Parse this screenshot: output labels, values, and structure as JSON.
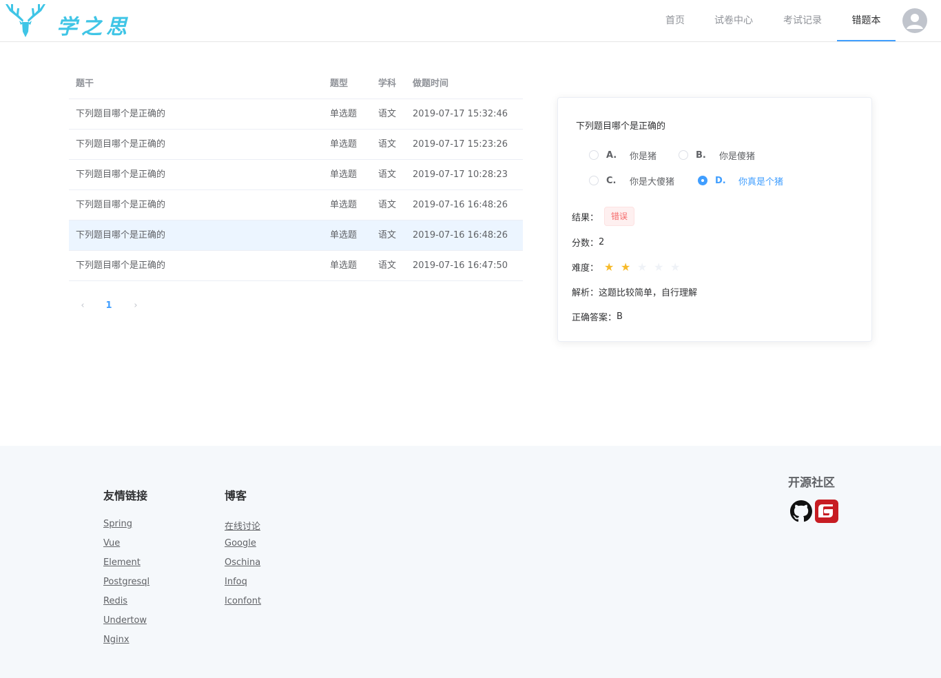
{
  "header": {
    "logo_text": "学之思",
    "nav": [
      {
        "label": "首页",
        "active": false
      },
      {
        "label": "试卷中心",
        "active": false
      },
      {
        "label": "考试记录",
        "active": false
      },
      {
        "label": "错题本",
        "active": true
      }
    ],
    "avatar_icon": "user-avatar-icon"
  },
  "table": {
    "headers": [
      "题干",
      "题型",
      "学科",
      "做题时间"
    ],
    "rows": [
      {
        "stem": "下列题目哪个是正确的",
        "type": "单选题",
        "subject": "语文",
        "time": "2019-07-17 15:32:46",
        "selected": false
      },
      {
        "stem": "下列题目哪个是正确的",
        "type": "单选题",
        "subject": "语文",
        "time": "2019-07-17 15:23:26",
        "selected": false
      },
      {
        "stem": "下列题目哪个是正确的",
        "type": "单选题",
        "subject": "语文",
        "time": "2019-07-17 10:28:23",
        "selected": false
      },
      {
        "stem": "下列题目哪个是正确的",
        "type": "单选题",
        "subject": "语文",
        "time": "2019-07-16 16:48:26",
        "selected": false
      },
      {
        "stem": "下列题目哪个是正确的",
        "type": "单选题",
        "subject": "语文",
        "time": "2019-07-16 16:48:26",
        "selected": true
      },
      {
        "stem": "下列题目哪个是正确的",
        "type": "单选题",
        "subject": "语文",
        "time": "2019-07-16 16:47:50",
        "selected": false
      }
    ]
  },
  "pagination": {
    "prev_icon": "chevron-left-icon",
    "page": "1",
    "next_icon": "chevron-right-icon"
  },
  "question": {
    "title": "下列题目哪个是正确的",
    "options": [
      {
        "key": "A.",
        "text": "你是猪",
        "checked": false
      },
      {
        "key": "B.",
        "text": "你是傻猪",
        "checked": false
      },
      {
        "key": "C.",
        "text": "你是大傻猪",
        "checked": false
      },
      {
        "key": "D.",
        "text": "你真是个猪",
        "checked": true
      }
    ],
    "result_label": "结果：",
    "result_value": "错误",
    "score_label": "分数：",
    "score_value": "2",
    "difficulty_label": "难度：",
    "difficulty_stars": 2,
    "difficulty_max": 5,
    "analysis_label": "解析：",
    "analysis_value": "这题比较简单，自行理解",
    "answer_label": "正确答案：",
    "answer_value": "B"
  },
  "footer": {
    "friend_links_title": "友情链接",
    "friend_links": [
      "Spring",
      "Vue",
      "Element",
      "Postgresql",
      "Redis",
      "Undertow",
      "Nginx"
    ],
    "blog_title": "博客",
    "blog_links": [
      "在线讨论",
      "Google",
      "Oschina",
      "Infoq",
      "Iconfont"
    ],
    "open_source_title": "开源社区",
    "icons": [
      "github-icon",
      "gitee-icon"
    ]
  },
  "colors": {
    "primary": "#409eff",
    "logo": "#3fc5e6",
    "danger": "#f56c6c",
    "star": "#f7ba2a",
    "gitee": "#c71d23"
  }
}
